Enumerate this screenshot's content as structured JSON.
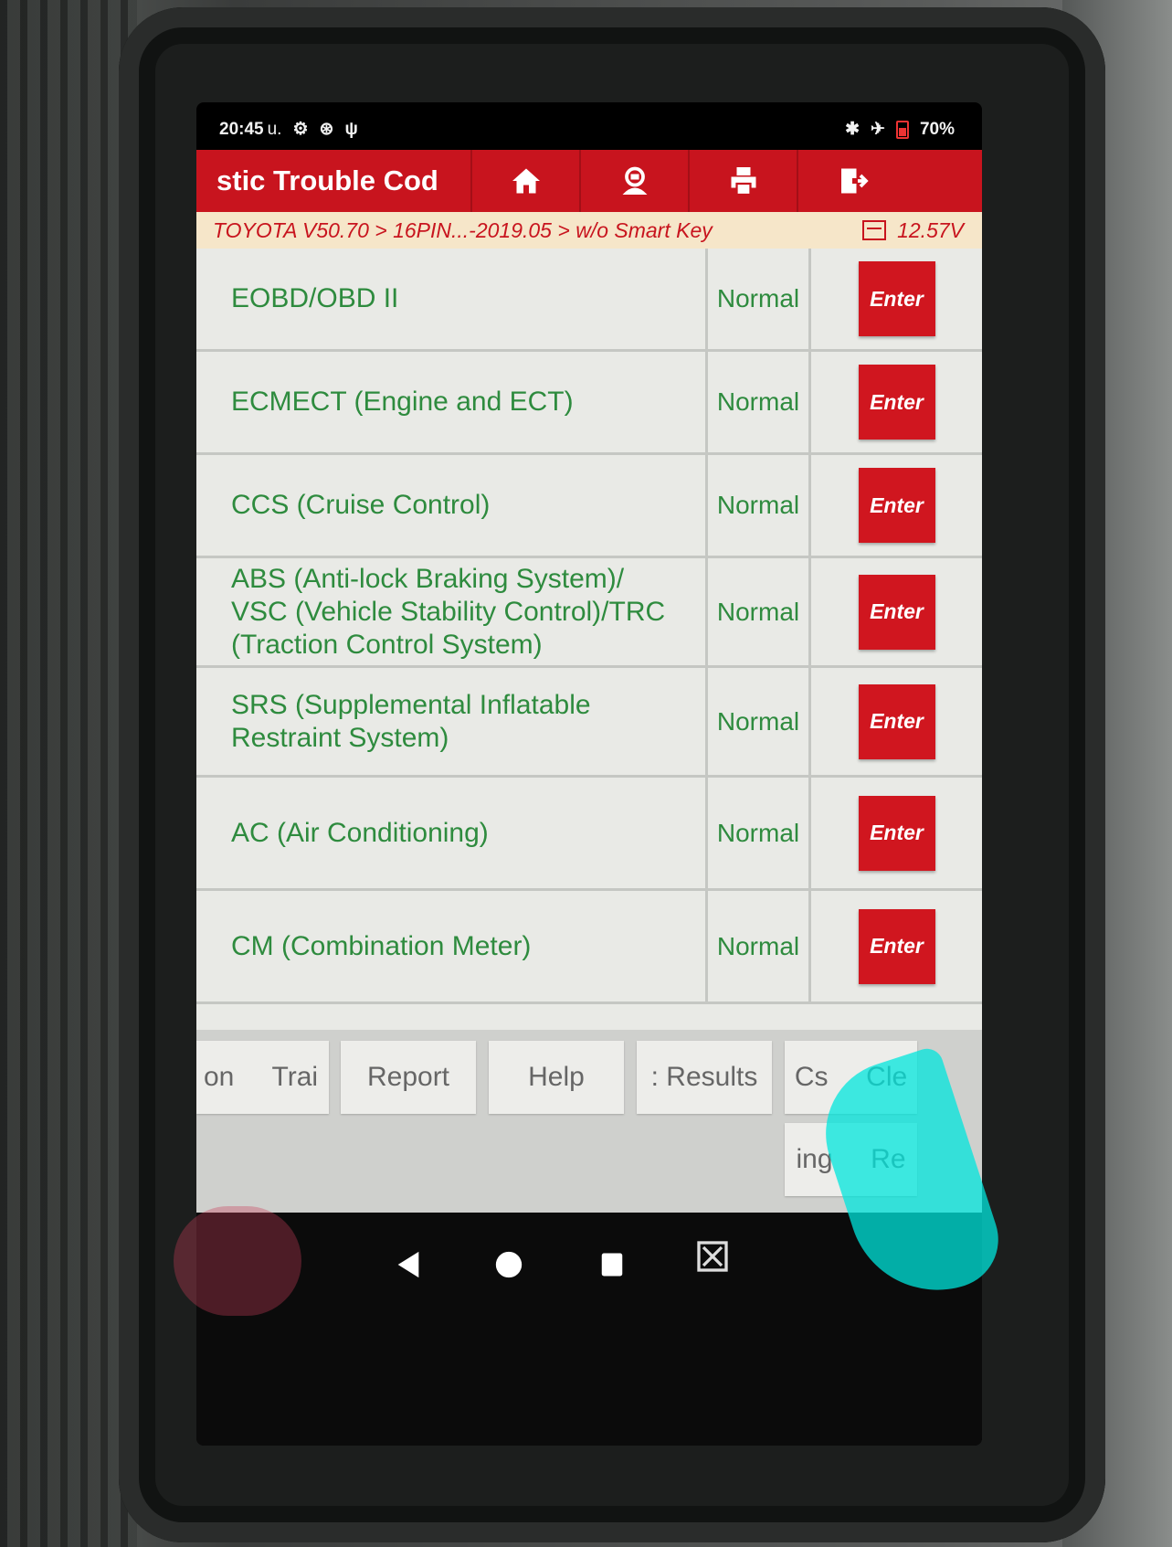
{
  "status_bar": {
    "time": "20:45",
    "time_suffix": "u.",
    "battery": "70%"
  },
  "app_bar": {
    "title": "stic Trouble Cod",
    "buttons": [
      {
        "icon": "home-icon"
      },
      {
        "icon": "support-icon"
      },
      {
        "icon": "print-icon"
      },
      {
        "icon": "exit-icon"
      }
    ]
  },
  "breadcrumb": {
    "path": "TOYOTA V50.70 > 16PIN...-2019.05 > w/o Smart Key",
    "voltage": "12.57V"
  },
  "systems": [
    {
      "name": "EOBD/OBD II",
      "status": "Normal",
      "action": "Enter"
    },
    {
      "name": "ECMECT (Engine and ECT)",
      "status": "Normal",
      "action": "Enter"
    },
    {
      "name": "CCS (Cruise Control)",
      "status": "Normal",
      "action": "Enter"
    },
    {
      "name": "ABS (Anti-lock Braking System)/ VSC (Vehicle Stability Control)/TRC (Traction Control System)",
      "status": "Normal",
      "action": "Enter"
    },
    {
      "name": "SRS (Supplemental Inflatable Restraint System)",
      "status": "Normal",
      "action": "Enter"
    },
    {
      "name": "AC (Air Conditioning)",
      "status": "Normal",
      "action": "Enter"
    },
    {
      "name": "CM (Combination Meter)",
      "status": "Normal",
      "action": "Enter"
    }
  ],
  "function_buttons": [
    {
      "label": "on     Trai"
    },
    {
      "label": "Report"
    },
    {
      "label": "Help"
    },
    {
      "label": ": Results"
    },
    {
      "label": "Cs     Cle"
    },
    {
      "label": "ing     Re"
    }
  ],
  "colors": {
    "brand_red": "#c8141e",
    "status_green": "#2e8b3e",
    "breadcrumb_bg": "#f6e6c9"
  }
}
